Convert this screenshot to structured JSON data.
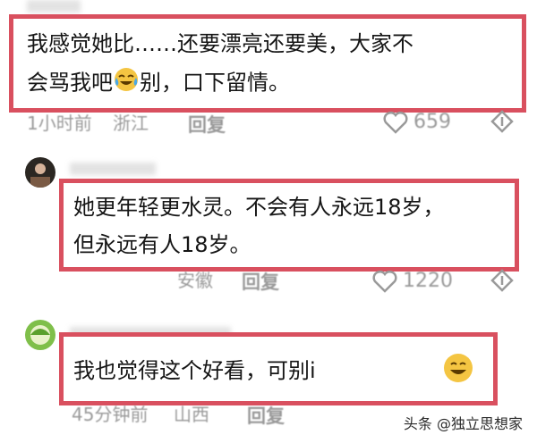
{
  "comments": [
    {
      "text_line1": "我感觉她比……还要漂亮还要美，大家不",
      "text_line2_a": "会骂我吧",
      "emoji": "crying-laughing-emoji",
      "text_line2_b": "别，口下留情。",
      "time": "1小时前",
      "location": "浙江",
      "reply_label": "回复",
      "likes": "659"
    },
    {
      "text_line1": "她更年轻更水灵。不会有人永远18岁，",
      "text_line2": "但永远有人18岁。",
      "time": "",
      "location": "安徽",
      "reply_label": "回复",
      "likes": "1220"
    },
    {
      "text_line1": "我也觉得这个好看，可别i",
      "emoji": "grinning-emoji",
      "time": "45分钟前",
      "location": "山西",
      "reply_label": "回复",
      "likes": ""
    }
  ],
  "watermark": {
    "source": "头条",
    "account": "@独立思想家"
  },
  "colors": {
    "highlight_border": "#d9505f",
    "meta_text": "#9a9a9a"
  }
}
